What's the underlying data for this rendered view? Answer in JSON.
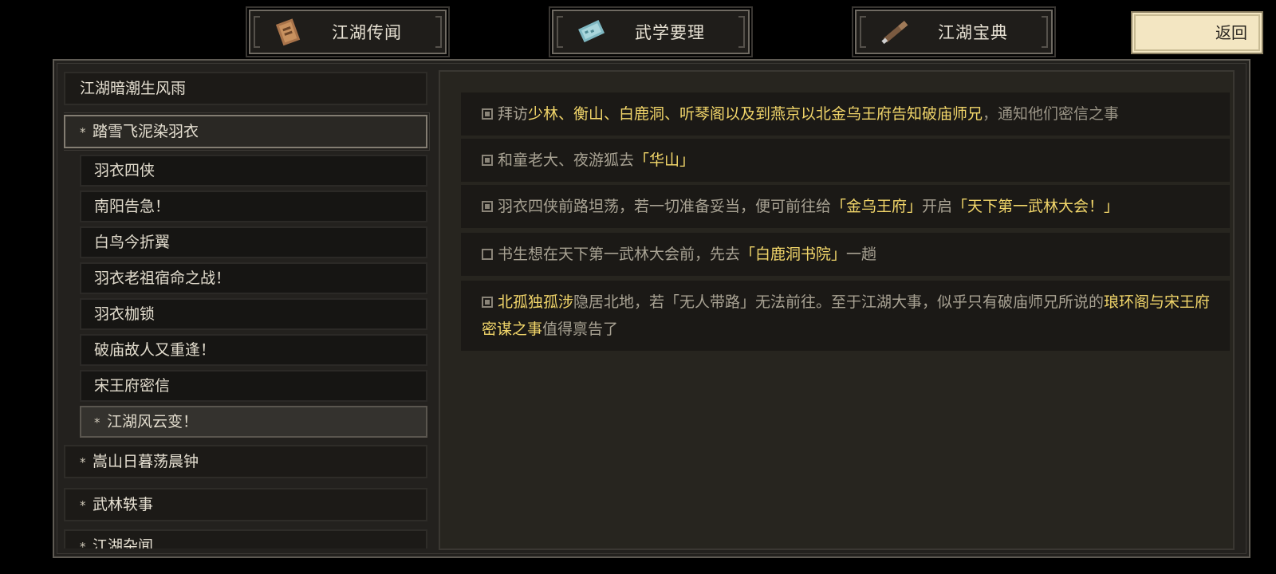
{
  "tabs": [
    {
      "label": "江湖传闻",
      "icon": "book-icon"
    },
    {
      "label": "武学要理",
      "icon": "scroll-icon"
    },
    {
      "label": "江湖宝典",
      "icon": "brush-icon"
    }
  ],
  "back_button": "返回",
  "categories": [
    {
      "label": "江湖暗潮生风雨"
    },
    {
      "label": "踏雪飞泥染羽衣",
      "open": true
    },
    {
      "label": "嵩山日暮荡晨钟"
    },
    {
      "label": "武林轶事"
    },
    {
      "label": "江湖杂闻"
    }
  ],
  "star": "*",
  "sub_items": [
    {
      "label": "羽衣四侠"
    },
    {
      "label": "南阳告急！"
    },
    {
      "label": "白鸟今折翼"
    },
    {
      "label": "羽衣老祖宿命之战！"
    },
    {
      "label": "羽衣枷锁"
    },
    {
      "label": "破庙故人又重逢！"
    },
    {
      "label": "宋王府密信"
    },
    {
      "label": "江湖风云变！",
      "active": true
    }
  ],
  "quests": [
    {
      "done": true,
      "parts": [
        "拜访",
        "少林、衡山、白鹿洞、听琴阁以及到燕京以北金乌王府告知破庙师兄",
        "，通知他们密信之事"
      ]
    },
    {
      "done": true,
      "parts": [
        "和童老大、夜游狐去",
        "「华山」"
      ]
    },
    {
      "done": true,
      "parts": [
        "羽衣四侠前路坦荡，若一切准备妥当，便可前往给",
        "「金乌王府」",
        "开启",
        "「天下第一武林大会！」"
      ]
    },
    {
      "done": false,
      "parts": [
        "书生想在天下第一武林大会前，先去",
        "「白鹿洞书院」",
        "一趟"
      ]
    },
    {
      "done": true,
      "parts": [
        "北孤独孤涉",
        "隐居北地，若「无人带路」无法前往。至于江湖大事，似乎只有破庙师兄所说的",
        "琅环阁与宋王府密谋之事",
        "值得禀告了"
      ]
    }
  ],
  "colors": {
    "highlight": "#f2d66a",
    "text": "#a8a293",
    "back_button_bg": "#f3e6c2"
  }
}
